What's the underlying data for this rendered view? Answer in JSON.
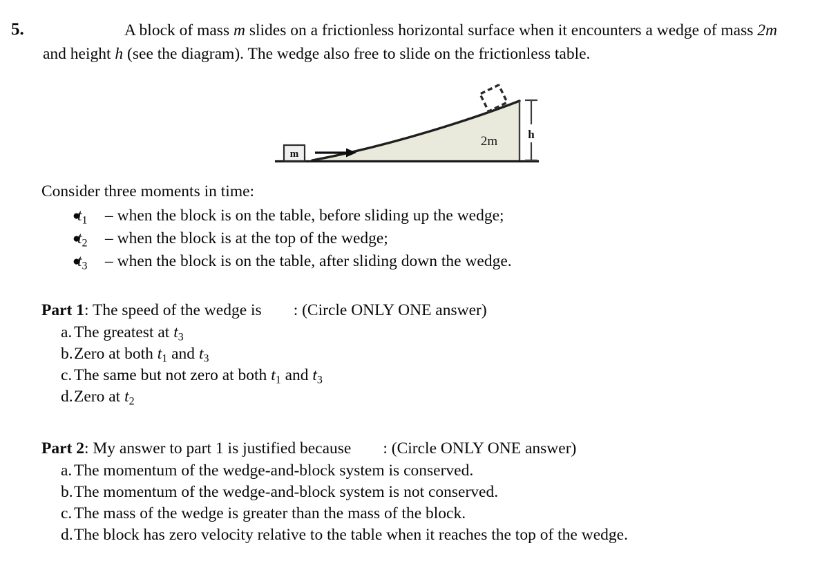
{
  "question": {
    "number": "5.",
    "text_part_1": "A block of mass ",
    "sym_m": "m",
    "text_part_2": " slides on a frictionless horizontal surface when it encounters a wedge of mass ",
    "sym_2m": "2m",
    "text_part_3": " and height ",
    "sym_h": "h",
    "text_part_4": " (see the diagram).  The wedge also free to slide on the frictionless table."
  },
  "diagram": {
    "block_label": "m",
    "wedge_label": "2m",
    "height_label": "h",
    "wedge_fill": "#e9e9dc",
    "block_fill": "#f0f0f0",
    "line_color": "#1a1a1a",
    "arrow_direction": "right"
  },
  "consider": {
    "heading": "Consider three moments in time:",
    "bullet_char": "●",
    "items": [
      {
        "symbol": "t",
        "subscript": "1",
        "text": "– when the block is on the table, before sliding up the wedge;"
      },
      {
        "symbol": "t",
        "subscript": "2",
        "text": "– when the block is at the top of the wedge;"
      },
      {
        "symbol": "t",
        "subscript": "3",
        "text": "– when the block is on the table, after sliding down the wedge."
      }
    ]
  },
  "part1": {
    "label": "Part 1",
    "prompt": ": The speed of the wedge is",
    "instruction": ": (Circle ONLY ONE answer)",
    "options": [
      {
        "letter": "a.",
        "pre": "The greatest at ",
        "sym": "t",
        "sub": "3",
        "post": ""
      },
      {
        "letter": "b.",
        "pre": "Zero at both ",
        "sym": "t",
        "sub": "1",
        "mid": " and ",
        "sym2": "t",
        "sub2": "3",
        "post": ""
      },
      {
        "letter": "c.",
        "pre": "The same but not zero at both ",
        "sym": "t",
        "sub": "1",
        "mid": " and ",
        "sym2": "t",
        "sub2": "3",
        "post": ""
      },
      {
        "letter": "d.",
        "pre": "Zero at ",
        "sym": "t",
        "sub": "2",
        "post": ""
      }
    ]
  },
  "part2": {
    "label": "Part 2",
    "prompt": ": My answer to part 1 is justified because",
    "instruction": ": (Circle ONLY ONE answer)",
    "options": [
      {
        "letter": "a.",
        "text": "The momentum of the wedge-and-block system is conserved."
      },
      {
        "letter": "b.",
        "text": "The momentum of the wedge-and-block system is not conserved."
      },
      {
        "letter": "c.",
        "text": "The mass of the wedge is greater than the mass of the block."
      },
      {
        "letter": "d.",
        "text": "The block has zero velocity relative to the table when it reaches the top of the wedge."
      }
    ]
  }
}
